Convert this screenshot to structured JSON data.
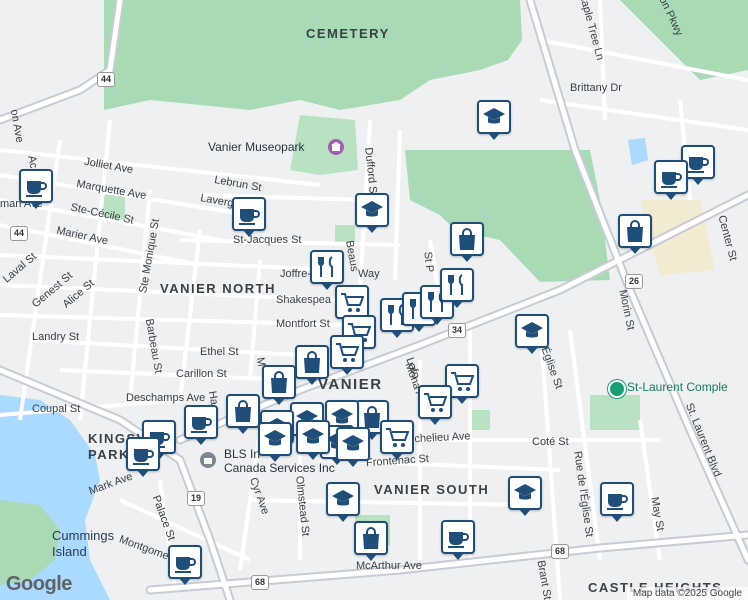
{
  "map": {
    "area_labels": [
      {
        "id": "cemetery",
        "text": "CEMETERY"
      },
      {
        "id": "vanier-north",
        "text": "VANIER NORTH"
      },
      {
        "id": "vanier",
        "text": "VANIER"
      },
      {
        "id": "vanier-south",
        "text": "VANIER SOUTH"
      },
      {
        "id": "kingsview-park-1",
        "text": "KINGSVIEW"
      },
      {
        "id": "kingsview-park-2",
        "text": "PARK"
      },
      {
        "id": "castle-heights",
        "text": "CASTLE HEIGHTS"
      }
    ],
    "poi_labels": {
      "museopark": "Vanier Museopark",
      "st_laurent": "St-Laurent Comple",
      "bls_1": "BLS In",
      "bls_2": "Canada Services Inc",
      "cummings_1": "Cummings",
      "cummings_2": "Island"
    },
    "street_labels": {
      "jolliet": "Jolliet Ave",
      "marquette": "Marquette Ave",
      "ste_cecile": "Ste-Cécile St",
      "marier": "Marier Ave",
      "laval": "Laval St",
      "genest": "Genest St",
      "alice": "Alice St",
      "landry": "Landry St",
      "lebrun": "Lebrun St",
      "lavergne": "Lavergne",
      "st_jacques": "St-Jacques St",
      "joffre_belanger": "Joffre-B",
      "way": "Way",
      "shakespeare": "Shakespea",
      "montfort": "Montfort St",
      "ethel": "Ethel St",
      "carillon": "Carillon St",
      "deschamps": "Deschamps Ave",
      "coupal": "Coupal St",
      "mark": "Mark Ave",
      "ste_monique": "Ste Monique St",
      "barbeau": "Barbeau St",
      "beausoleil": "Beaus",
      "dufford": "Dufford St",
      "st_p": "St P",
      "mona": "Mona Ave",
      "lafortune": "Lafo",
      "richelieu": "Richelieu Ave",
      "frontenac": "Frontenac St",
      "cote": "Coté St",
      "rue_eglise": "Rue de l'Église St",
      "eglise": "Église St",
      "cyr": "Cyr Ave",
      "olmstead": "Olmstead St",
      "palace": "Palace St",
      "montgomery": "Montgome",
      "mcarthur": "McArthur Ave",
      "brant": "Brant St",
      "may": "May St",
      "morin": "Morin St",
      "st_laurent_blvd": "St. Laurent Blvd",
      "center": "Center St",
      "brittany": "Brittany Dr",
      "maple_tree": "Maple Tree Ln",
      "aviation": "iation Pkwy",
      "ac": "Ac",
      "man_ave": "man Ave",
      "on_ave": "on Ave",
      "ha": "Ha",
      "m_st": "M"
    },
    "road_shields": {
      "r44a": "44",
      "r44b": "44",
      "r34": "34",
      "r26": "26",
      "r19": "19",
      "r68a": "68",
      "r68b": "68"
    },
    "markers": [
      {
        "type": "school"
      },
      {
        "type": "coffee"
      },
      {
        "type": "coffee"
      },
      {
        "type": "shopping"
      },
      {
        "type": "coffee"
      },
      {
        "type": "school"
      },
      {
        "type": "coffee"
      },
      {
        "type": "shopping"
      },
      {
        "type": "restaurant"
      },
      {
        "type": "school"
      },
      {
        "type": "grocery"
      },
      {
        "type": "restaurant"
      },
      {
        "type": "restaurant"
      },
      {
        "type": "restaurant"
      },
      {
        "type": "restaurant"
      },
      {
        "type": "grocery"
      },
      {
        "type": "grocery"
      },
      {
        "type": "shopping"
      },
      {
        "type": "shopping"
      },
      {
        "type": "grocery"
      },
      {
        "type": "grocery"
      },
      {
        "type": "shopping"
      },
      {
        "type": "shopping"
      },
      {
        "type": "coffee"
      },
      {
        "type": "coffee"
      },
      {
        "type": "coffee"
      },
      {
        "type": "school"
      },
      {
        "type": "school"
      },
      {
        "type": "school"
      },
      {
        "type": "grocery"
      },
      {
        "type": "school"
      },
      {
        "type": "school"
      },
      {
        "type": "school"
      },
      {
        "type": "coffee"
      },
      {
        "type": "school"
      },
      {
        "type": "shopping"
      },
      {
        "type": "coffee"
      },
      {
        "type": "coffee"
      },
      {
        "type": "school"
      },
      {
        "type": "school"
      }
    ],
    "attribution": {
      "logo": "Google",
      "credit": "Map data ©2025 Google"
    },
    "colors": {
      "marker_border": "#1f4e79",
      "park": "#a8dab5",
      "water": "#aadaff",
      "road": "#ffffff",
      "arterial": "#c7ccd3",
      "poi_green": "#1a9e75"
    }
  }
}
